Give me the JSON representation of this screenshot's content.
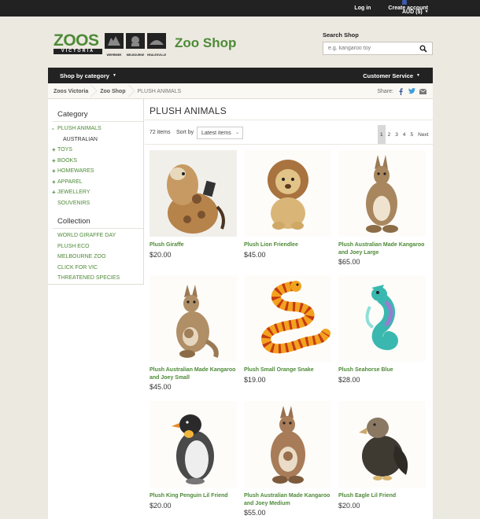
{
  "topbar": {
    "login": "Log in",
    "create_account": "Create account",
    "currency": "AUD ($)"
  },
  "logo": {
    "brand": "ZOOS",
    "brand_sub": "VICTORIA",
    "sites": [
      "WERRIBEE",
      "MELBOURNE",
      "HEALESVILLE"
    ]
  },
  "shop_title": "Zoo Shop",
  "search": {
    "label": "Search Shop",
    "placeholder": "e.g. kangaroo toy"
  },
  "nav": {
    "shop_by_category": "Shop by category",
    "customer_service": "Customer Service"
  },
  "breadcrumb": [
    "Zoos Victoria",
    "Zoo Shop",
    "PLUSH ANIMALS"
  ],
  "share_label": "Share:",
  "sidebar": {
    "category_heading": "Category",
    "categories": [
      {
        "marker": "-",
        "label": "PLUSH ANIMALS"
      },
      {
        "marker": "",
        "label": "AUSTRALIAN",
        "sub": true
      },
      {
        "marker": "+",
        "label": "TOYS"
      },
      {
        "marker": "+",
        "label": "BOOKS"
      },
      {
        "marker": "+",
        "label": "HOMEWARES"
      },
      {
        "marker": "+",
        "label": "APPAREL"
      },
      {
        "marker": "+",
        "label": "JEWELLERY"
      },
      {
        "marker": "",
        "label": "SOUVENIRS"
      }
    ],
    "collection_heading": "Collection",
    "collections": [
      "WORLD GIRAFFE DAY",
      "PLUSH ECO",
      "MELBOURNE ZOO",
      "CLICK FOR VIC",
      "THREATENED SPECIES"
    ]
  },
  "main": {
    "title": "PLUSH ANIMALS",
    "item_count": "72 items",
    "sort_label": "Sort by",
    "sort_value": "Latest items",
    "pages": [
      "1",
      "2",
      "3",
      "4",
      "5",
      "Next"
    ],
    "active_page": "1"
  },
  "products": [
    {
      "name": "Plush Giraffe",
      "price": "$20.00",
      "image": "giraffe"
    },
    {
      "name": "Plush Lion Friendlee",
      "price": "$45.00",
      "image": "lion"
    },
    {
      "name": "Plush Australian Made Kangaroo and Joey Large",
      "price": "$65.00",
      "image": "kangaroo"
    },
    {
      "name": "Plush Australian Made Kangaroo and Joey Small",
      "price": "$45.00",
      "image": "kangaroo"
    },
    {
      "name": "Plush Small Orange Snake",
      "price": "$19.00",
      "image": "snake"
    },
    {
      "name": "Plush Seahorse Blue",
      "price": "$28.00",
      "image": "seahorse"
    },
    {
      "name": "Plush King Penguin Lil Friend",
      "price": "$20.00",
      "image": "penguin"
    },
    {
      "name": "Plush Australian Made Kangaroo and Joey Medium",
      "price": "$55.00",
      "image": "kangaroo"
    },
    {
      "name": "Plush Eagle Lil Friend",
      "price": "$20.00",
      "image": "eagle"
    }
  ]
}
